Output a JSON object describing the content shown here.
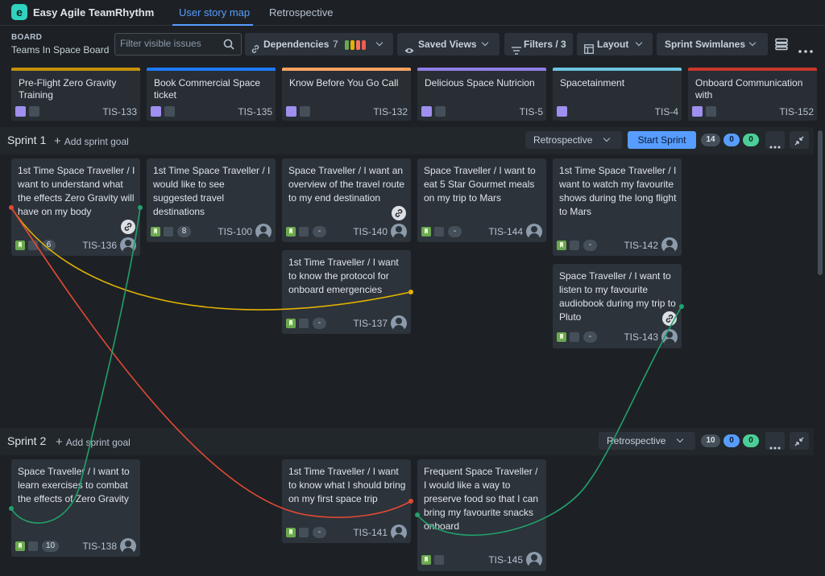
{
  "app": {
    "name": "Easy Agile TeamRhythm",
    "logo_letter": "e",
    "tabs": [
      {
        "label": "User story map",
        "active": true
      },
      {
        "label": "Retrospective",
        "active": false
      }
    ]
  },
  "toolbar": {
    "board_label": "BOARD",
    "board_name": "Teams In Space Board",
    "search_placeholder": "Filter visible issues",
    "dependencies_label": "Dependencies",
    "dependencies_count": "7",
    "dependency_colors": [
      "#6aa84f",
      "#e2b203",
      "#f87462",
      "#f15b50"
    ],
    "saved_views_label": "Saved Views",
    "filters_label": "Filters / 3",
    "layout_label": "Layout",
    "swimlanes_label": "Sprint Swimlanes"
  },
  "epics": [
    {
      "title": "Pre-Flight Zero Gravity Training",
      "key": "TIS-133",
      "color": "#c39009"
    },
    {
      "title": "Book Commercial Space ticket",
      "key": "TIS-135",
      "color": "#1d7afc"
    },
    {
      "title": "Know Before You Go Call",
      "key": "TIS-132",
      "color": "#fea362"
    },
    {
      "title": "Delicious Space Nutricion",
      "key": "TIS-5",
      "color": "#8f7ee7"
    },
    {
      "title": "Spacetainment",
      "key": "TIS-4",
      "color": "#6cc3e0"
    },
    {
      "title": "Onboard Communication with",
      "key": "TIS-152",
      "color": "#c9372c"
    }
  ],
  "sprints": [
    {
      "title": "Sprint 1",
      "add_goal": "Add sprint goal",
      "retro_label": "Retrospective",
      "start_label": "Start Sprint",
      "counts": [
        "14",
        "0",
        "0"
      ]
    },
    {
      "title": "Sprint 2",
      "add_goal": "Add sprint goal",
      "retro_label": "Retrospective",
      "counts": [
        "10",
        "0",
        "0"
      ]
    }
  ],
  "cards": [
    {
      "text": "1st Time Space Traveller / I want to understand what the effects Zero Gravity will have on my body",
      "key": "TIS-136",
      "estimate": "6"
    },
    {
      "text": "1st Time Space Traveller / I would like to see suggested travel destinations",
      "key": "TIS-100",
      "estimate": "8"
    },
    {
      "text": "Space Traveller / I want an overview of the travel route to my end destination",
      "key": "TIS-140",
      "estimate": "-"
    },
    {
      "text": "1st Time Traveller / I want to know the protocol for onboard emergencies",
      "key": "TIS-137",
      "estimate": "-"
    },
    {
      "text": "Space Traveller / I want to eat 5 Star Gourmet meals on my trip to Mars",
      "key": "TIS-144",
      "estimate": "-"
    },
    {
      "text": "1st Time Space Traveller / I want to watch my favourite shows during the long flight to Mars",
      "key": "TIS-142",
      "estimate": "-"
    },
    {
      "text": "Space Traveller / I want to listen to my favourite audiobook during my trip to Pluto",
      "key": "TIS-143",
      "estimate": "-"
    },
    {
      "text": "Space Traveller / I want to learn exercises to combat the effects of Zero Gravity",
      "key": "TIS-138",
      "estimate": "10"
    },
    {
      "text": "1st Time Traveller / I want to know what I should bring on my first space trip",
      "key": "TIS-141",
      "estimate": "-"
    },
    {
      "text": "Frequent Space Traveller / I would like a way to preserve food so that I can bring my favourite snacks onboard",
      "key": "TIS-145",
      "estimate": "-"
    }
  ],
  "colors": {
    "dependency_green": "#22a06b",
    "dependency_yellow": "#e2b203",
    "dependency_red": "#e34935",
    "accent": "#579dff"
  }
}
